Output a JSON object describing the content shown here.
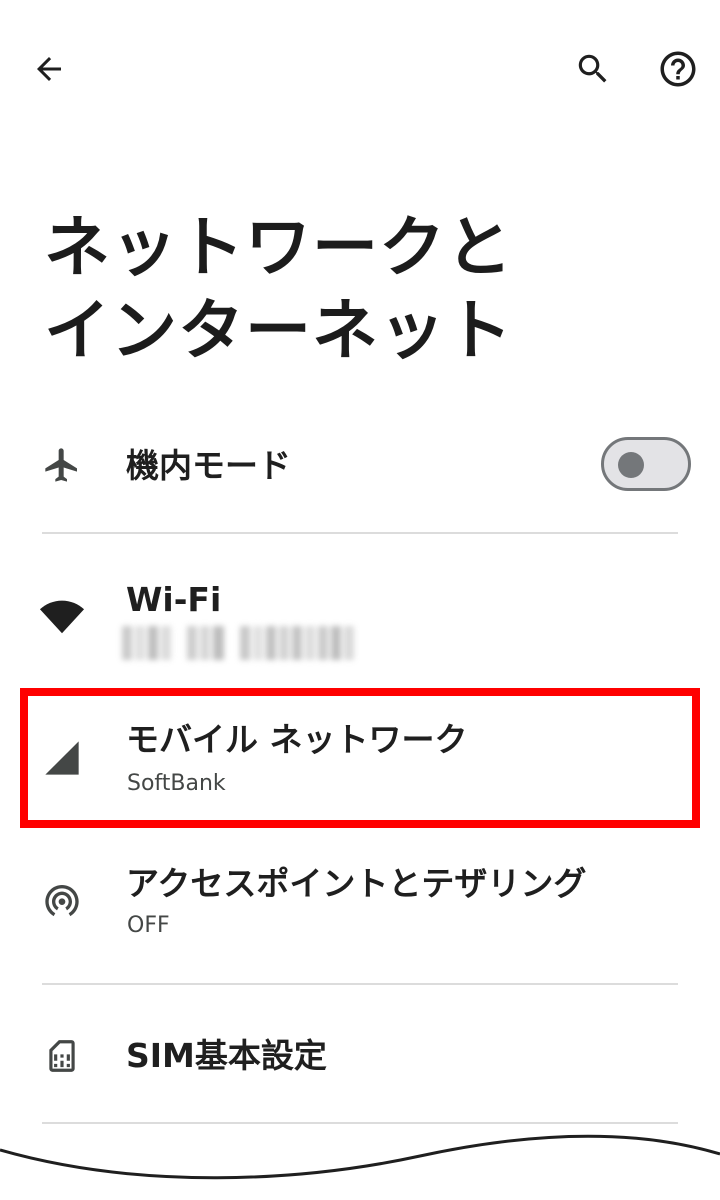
{
  "page": {
    "title_line1": "ネットワークと",
    "title_line2": "インターネット"
  },
  "topbar": {
    "back_icon": "arrow-back-icon",
    "search_icon": "search-icon",
    "help_icon": "help-circle-icon"
  },
  "settings": {
    "airplane": {
      "title": "機内モード",
      "icon": "airplane-icon",
      "toggle_on": false
    },
    "wifi": {
      "title": "Wi-Fi",
      "icon": "wifi-icon",
      "subtitle_redacted": true
    },
    "mobile_network": {
      "title": "モバイル ネットワーク",
      "subtitle": "SoftBank",
      "icon": "cellular-signal-icon",
      "highlighted": true
    },
    "hotspot": {
      "title": "アクセスポイントとテザリング",
      "subtitle": "OFF",
      "icon": "hotspot-icon"
    },
    "sim": {
      "title": "SIM基本設定",
      "icon": "sim-card-icon"
    }
  },
  "colors": {
    "highlight": "#ff0000",
    "text_primary": "#1f1f1f",
    "text_secondary": "#444746",
    "divider": "#dcdcdc",
    "toggle_track": "#e3e3e6",
    "toggle_outline": "#74777a"
  }
}
